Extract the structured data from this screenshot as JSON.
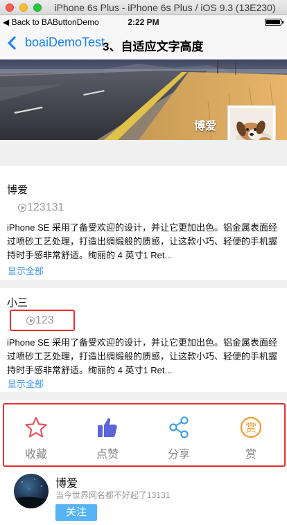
{
  "simulator": {
    "window_title": "iPhone 6s Plus - iPhone 6s Plus / iOS 9.3 (13E230)"
  },
  "status_bar": {
    "back_app": "Back to BAButtonDemo",
    "time": "2:22 PM",
    "battery_level": 1.0
  },
  "nav": {
    "back_label": "boaiDemoTest",
    "title": "3、自适应文字高度"
  },
  "header": {
    "name": "博爱"
  },
  "posts": [
    {
      "name": "博爱",
      "count": "123131",
      "body": "iPhone SE 采用了备受欢迎的设计，并让它更加出色。铝金属表面经过喷砂工艺处理，打造出绸缎般的质感，让这款小巧、轻便的手机握持时手感非常舒适。绚丽的 4 英寸1 Ret...",
      "show_all": "显示全部"
    },
    {
      "name": "小三",
      "count": "123",
      "body": "iPhone SE 采用了备受欢迎的设计，并让它更加出色。铝金属表面经过喷砂工艺处理，打造出绸缎般的质感，让这款小巧、轻便的手机握持时手感非常舒适。绚丽的 4 英寸1 Ret...",
      "show_all": "显示全部"
    }
  ],
  "actions": [
    {
      "label": "收藏",
      "icon": "star-icon",
      "color": "#e8545a"
    },
    {
      "label": "点赞",
      "icon": "thumbs-up-icon",
      "color": "#5965d8"
    },
    {
      "label": "分享",
      "icon": "share-icon",
      "color": "#3f9fe6"
    },
    {
      "label": "赏",
      "icon": "reward-icon",
      "color": "#f39a2c"
    }
  ],
  "footer_user": {
    "name": "博爱",
    "subtitle": "当今世界网名都不好起了13131",
    "follow_label": "关注"
  },
  "highlight_color": "#e62e2e",
  "link_color": "#3d95e8",
  "ios_tint": "#157efb"
}
